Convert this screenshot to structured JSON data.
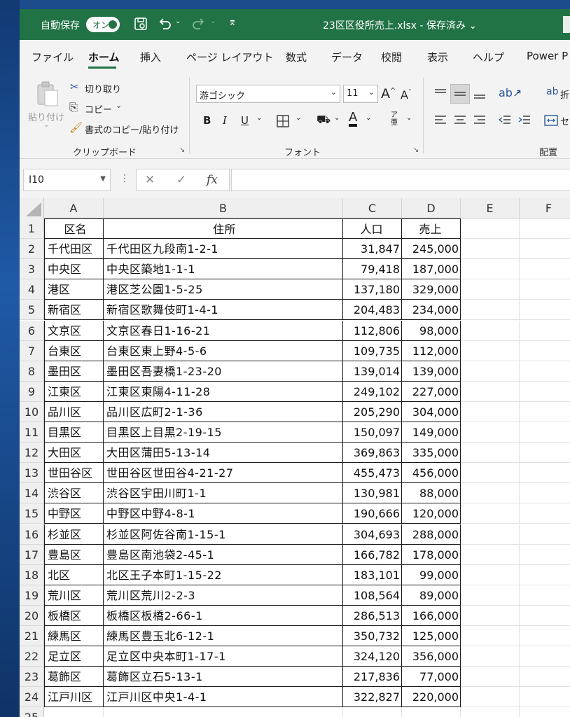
{
  "titlebar": {
    "autosave_label": "自動保存",
    "autosave_toggle": "オン",
    "file_title": "23区区役所売上.xlsx - 保存済み ⌄"
  },
  "tabs": [
    "ファイル",
    "ホーム",
    "挿入",
    "ページ レイアウト",
    "数式",
    "データ",
    "校閲",
    "表示",
    "ヘルプ",
    "Power P"
  ],
  "active_tab": "ホーム",
  "ribbon": {
    "clipboard": {
      "paste": "貼り付け",
      "cut": "切り取り",
      "copy": "コピー",
      "format_painter": "書式のコピー/貼り付け",
      "label": "クリップボード"
    },
    "font": {
      "font_name": "游ゴシック",
      "font_size": "11",
      "bold": "B",
      "italic": "I",
      "underline": "U",
      "grow": "A^",
      "shrink": "A^",
      "font_color": "A",
      "phonetic": "ア亜",
      "label": "フォント"
    },
    "alignment": {
      "wrap": "折",
      "merge": "セ",
      "label": "配置"
    }
  },
  "formula_bar": {
    "name_box": "I10",
    "cancel": "✕",
    "enter": "✓",
    "fx": "fx",
    "content": ""
  },
  "columns": [
    "A",
    "B",
    "C",
    "D",
    "E",
    "F"
  ],
  "rows": [
    {
      "n": "1",
      "a": "区名",
      "b": "住所",
      "c": "人口",
      "d": "売上"
    },
    {
      "n": "2",
      "a": "千代田区",
      "b": "千代田区九段南1-2-1",
      "c": "31,847",
      "d": "245,000"
    },
    {
      "n": "3",
      "a": "中央区",
      "b": "中央区築地1-1-1",
      "c": "79,418",
      "d": "187,000"
    },
    {
      "n": "4",
      "a": "港区",
      "b": "港区芝公園1-5-25",
      "c": "137,180",
      "d": "329,000"
    },
    {
      "n": "5",
      "a": "新宿区",
      "b": "新宿区歌舞伎町1-4-1",
      "c": "204,483",
      "d": "234,000"
    },
    {
      "n": "6",
      "a": "文京区",
      "b": "文京区春日1-16-21",
      "c": "112,806",
      "d": "98,000"
    },
    {
      "n": "7",
      "a": "台東区",
      "b": "台東区東上野4-5-6",
      "c": "109,735",
      "d": "112,000"
    },
    {
      "n": "8",
      "a": "墨田区",
      "b": "墨田区吾妻橋1-23-20",
      "c": "139,014",
      "d": "139,000"
    },
    {
      "n": "9",
      "a": "江東区",
      "b": "江東区東陽4-11-28",
      "c": "249,102",
      "d": "227,000"
    },
    {
      "n": "10",
      "a": "品川区",
      "b": "品川区広町2-1-36",
      "c": "205,290",
      "d": "304,000"
    },
    {
      "n": "11",
      "a": "目黒区",
      "b": "目黒区上目黒2-19-15",
      "c": "150,097",
      "d": "149,000"
    },
    {
      "n": "12",
      "a": "大田区",
      "b": "大田区蒲田5-13-14",
      "c": "369,863",
      "d": "335,000"
    },
    {
      "n": "13",
      "a": "世田谷区",
      "b": "世田谷区世田谷4-21-27",
      "c": "455,473",
      "d": "456,000"
    },
    {
      "n": "14",
      "a": "渋谷区",
      "b": "渋谷区宇田川町1-1",
      "c": "130,981",
      "d": "88,000"
    },
    {
      "n": "15",
      "a": "中野区",
      "b": "中野区中野4-8-1",
      "c": "190,666",
      "d": "120,000"
    },
    {
      "n": "16",
      "a": "杉並区",
      "b": "杉並区阿佐谷南1-15-1",
      "c": "304,693",
      "d": "288,000"
    },
    {
      "n": "17",
      "a": "豊島区",
      "b": "豊島区南池袋2-45-1",
      "c": "166,782",
      "d": "178,000"
    },
    {
      "n": "18",
      "a": "北区",
      "b": "北区王子本町1-15-22",
      "c": "183,101",
      "d": "99,000"
    },
    {
      "n": "19",
      "a": "荒川区",
      "b": "荒川区荒川2-2-3",
      "c": "108,564",
      "d": "89,000"
    },
    {
      "n": "20",
      "a": "板橋区",
      "b": "板橋区板橋2-66-1",
      "c": "286,513",
      "d": "166,000"
    },
    {
      "n": "21",
      "a": "練馬区",
      "b": "練馬区豊玉北6-12-1",
      "c": "350,732",
      "d": "125,000"
    },
    {
      "n": "22",
      "a": "足立区",
      "b": "足立区中央本町1-17-1",
      "c": "324,120",
      "d": "356,000"
    },
    {
      "n": "23",
      "a": "葛飾区",
      "b": "葛飾区立石5-13-1",
      "c": "217,836",
      "d": "77,000"
    },
    {
      "n": "24",
      "a": "江戸川区",
      "b": "江戸川区中央1-4-1",
      "c": "322,827",
      "d": "220,000"
    },
    {
      "n": "25",
      "a": "",
      "b": "",
      "c": "",
      "d": ""
    }
  ]
}
